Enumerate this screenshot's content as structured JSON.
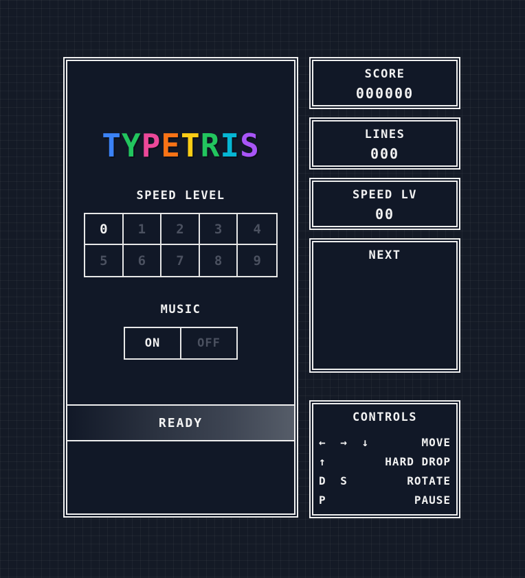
{
  "logo": {
    "letters": [
      {
        "char": "T",
        "color": "#3b82f6"
      },
      {
        "char": "Y",
        "color": "#22c55e"
      },
      {
        "char": "P",
        "color": "#ec4899"
      },
      {
        "char": "E",
        "color": "#f97316"
      },
      {
        "char": "T",
        "color": "#facc15"
      },
      {
        "char": "R",
        "color": "#ef4444"
      },
      {
        "char": "I",
        "color": "#22c55e"
      },
      {
        "char": "S",
        "color": "#06b6d4"
      },
      {
        "char": "S",
        "color": "#a855f7"
      }
    ],
    "text": "TYPETRIS"
  },
  "speed_level": {
    "title": "SPEED LEVEL",
    "levels": [
      "0",
      "1",
      "2",
      "3",
      "4",
      "5",
      "6",
      "7",
      "8",
      "9"
    ],
    "selected": "0"
  },
  "music": {
    "title": "MUSIC",
    "on_label": "ON",
    "off_label": "OFF",
    "selected": "ON"
  },
  "ready_label": "READY",
  "stats": {
    "score": {
      "label": "SCORE",
      "value": "000000"
    },
    "lines": {
      "label": "LINES",
      "value": "000"
    },
    "speed": {
      "label": "SPEED LV",
      "value": "00"
    }
  },
  "next": {
    "label": "NEXT"
  },
  "controls": {
    "title": "CONTROLS",
    "rows": [
      {
        "keys": "← → ↓",
        "action": "MOVE"
      },
      {
        "keys": "↑",
        "action": "HARD DROP"
      },
      {
        "keys": "D S",
        "action": "ROTATE"
      },
      {
        "keys": "P",
        "action": "PAUSE"
      }
    ]
  }
}
